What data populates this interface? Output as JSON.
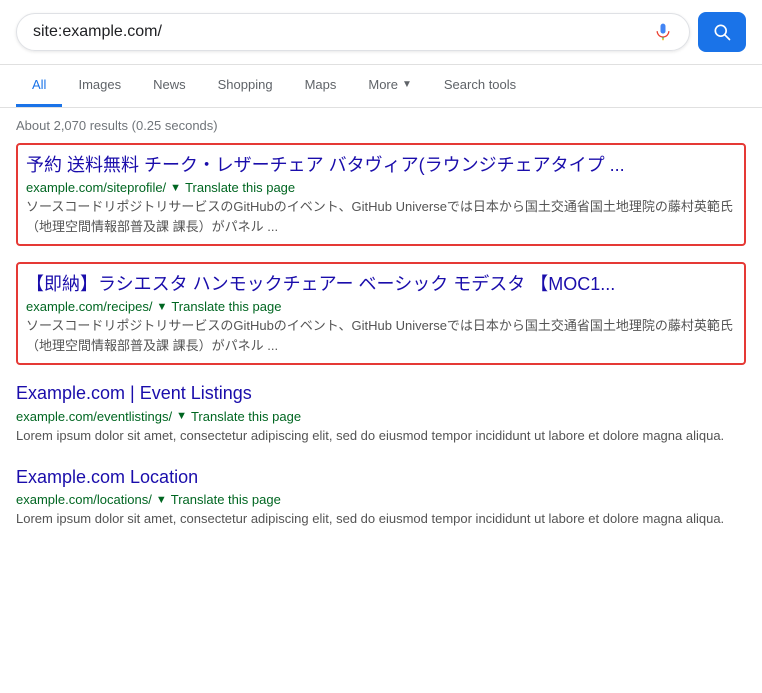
{
  "searchbar": {
    "query": "site:example.com/",
    "placeholder": "Search"
  },
  "nav": {
    "tabs": [
      {
        "id": "all",
        "label": "All",
        "active": true
      },
      {
        "id": "images",
        "label": "Images",
        "active": false
      },
      {
        "id": "news",
        "label": "News",
        "active": false
      },
      {
        "id": "shopping",
        "label": "Shopping",
        "active": false
      },
      {
        "id": "maps",
        "label": "Maps",
        "active": false
      },
      {
        "id": "more",
        "label": "More",
        "active": false,
        "hasDropdown": true
      },
      {
        "id": "search-tools",
        "label": "Search tools",
        "active": false
      }
    ]
  },
  "results_info": "About 2,070 results (0.25 seconds)",
  "results": [
    {
      "id": "result-1",
      "highlighted": true,
      "title": "予約 送料無料 チーク・レザーチェア バタヴィア(ラウンジチェアタイプ ...",
      "url": "example.com/siteprofile/",
      "translate_text": "Translate this page",
      "snippet": "ソースコードリポジトリサービスのGitHubのイベント、GitHub Universeでは日本から国土交通省国土地理院の藤村英範氏（地理空間情報部普及課 課長）がパネル ..."
    },
    {
      "id": "result-2",
      "highlighted": true,
      "title": "【即納】ラシエスタ ハンモックチェアー ベーシック モデスタ 【MOC1...",
      "url": "example.com/recipes/",
      "translate_text": "Translate this page",
      "snippet": "ソースコードリポジトリサービスのGitHubのイベント、GitHub Universeでは日本から国土交通省国土地理院の藤村英範氏（地理空間情報部普及課 課長）がパネル ..."
    },
    {
      "id": "result-3",
      "highlighted": false,
      "title": "Example.com | Event Listings",
      "url": "example.com/eventlistings/",
      "translate_text": "Translate this page",
      "snippet": "Lorem ipsum dolor sit amet, consectetur adipiscing elit, sed do eiusmod tempor incididunt ut labore et dolore magna aliqua."
    },
    {
      "id": "result-4",
      "highlighted": false,
      "title": "Example.com Location",
      "url": "example.com/locations/",
      "translate_text": "Translate this page",
      "snippet": "Lorem ipsum dolor sit amet, consectetur adipiscing elit, sed do eiusmod tempor incididunt ut labore et dolore magna aliqua."
    }
  ],
  "icons": {
    "mic": "mic-icon",
    "search": "search-icon",
    "arrow_down": "▼"
  },
  "colors": {
    "blue": "#1a73e8",
    "link": "#1a0dab",
    "green": "#006621",
    "red_border": "#e53935",
    "snippet": "#545454",
    "meta": "#70757a"
  }
}
